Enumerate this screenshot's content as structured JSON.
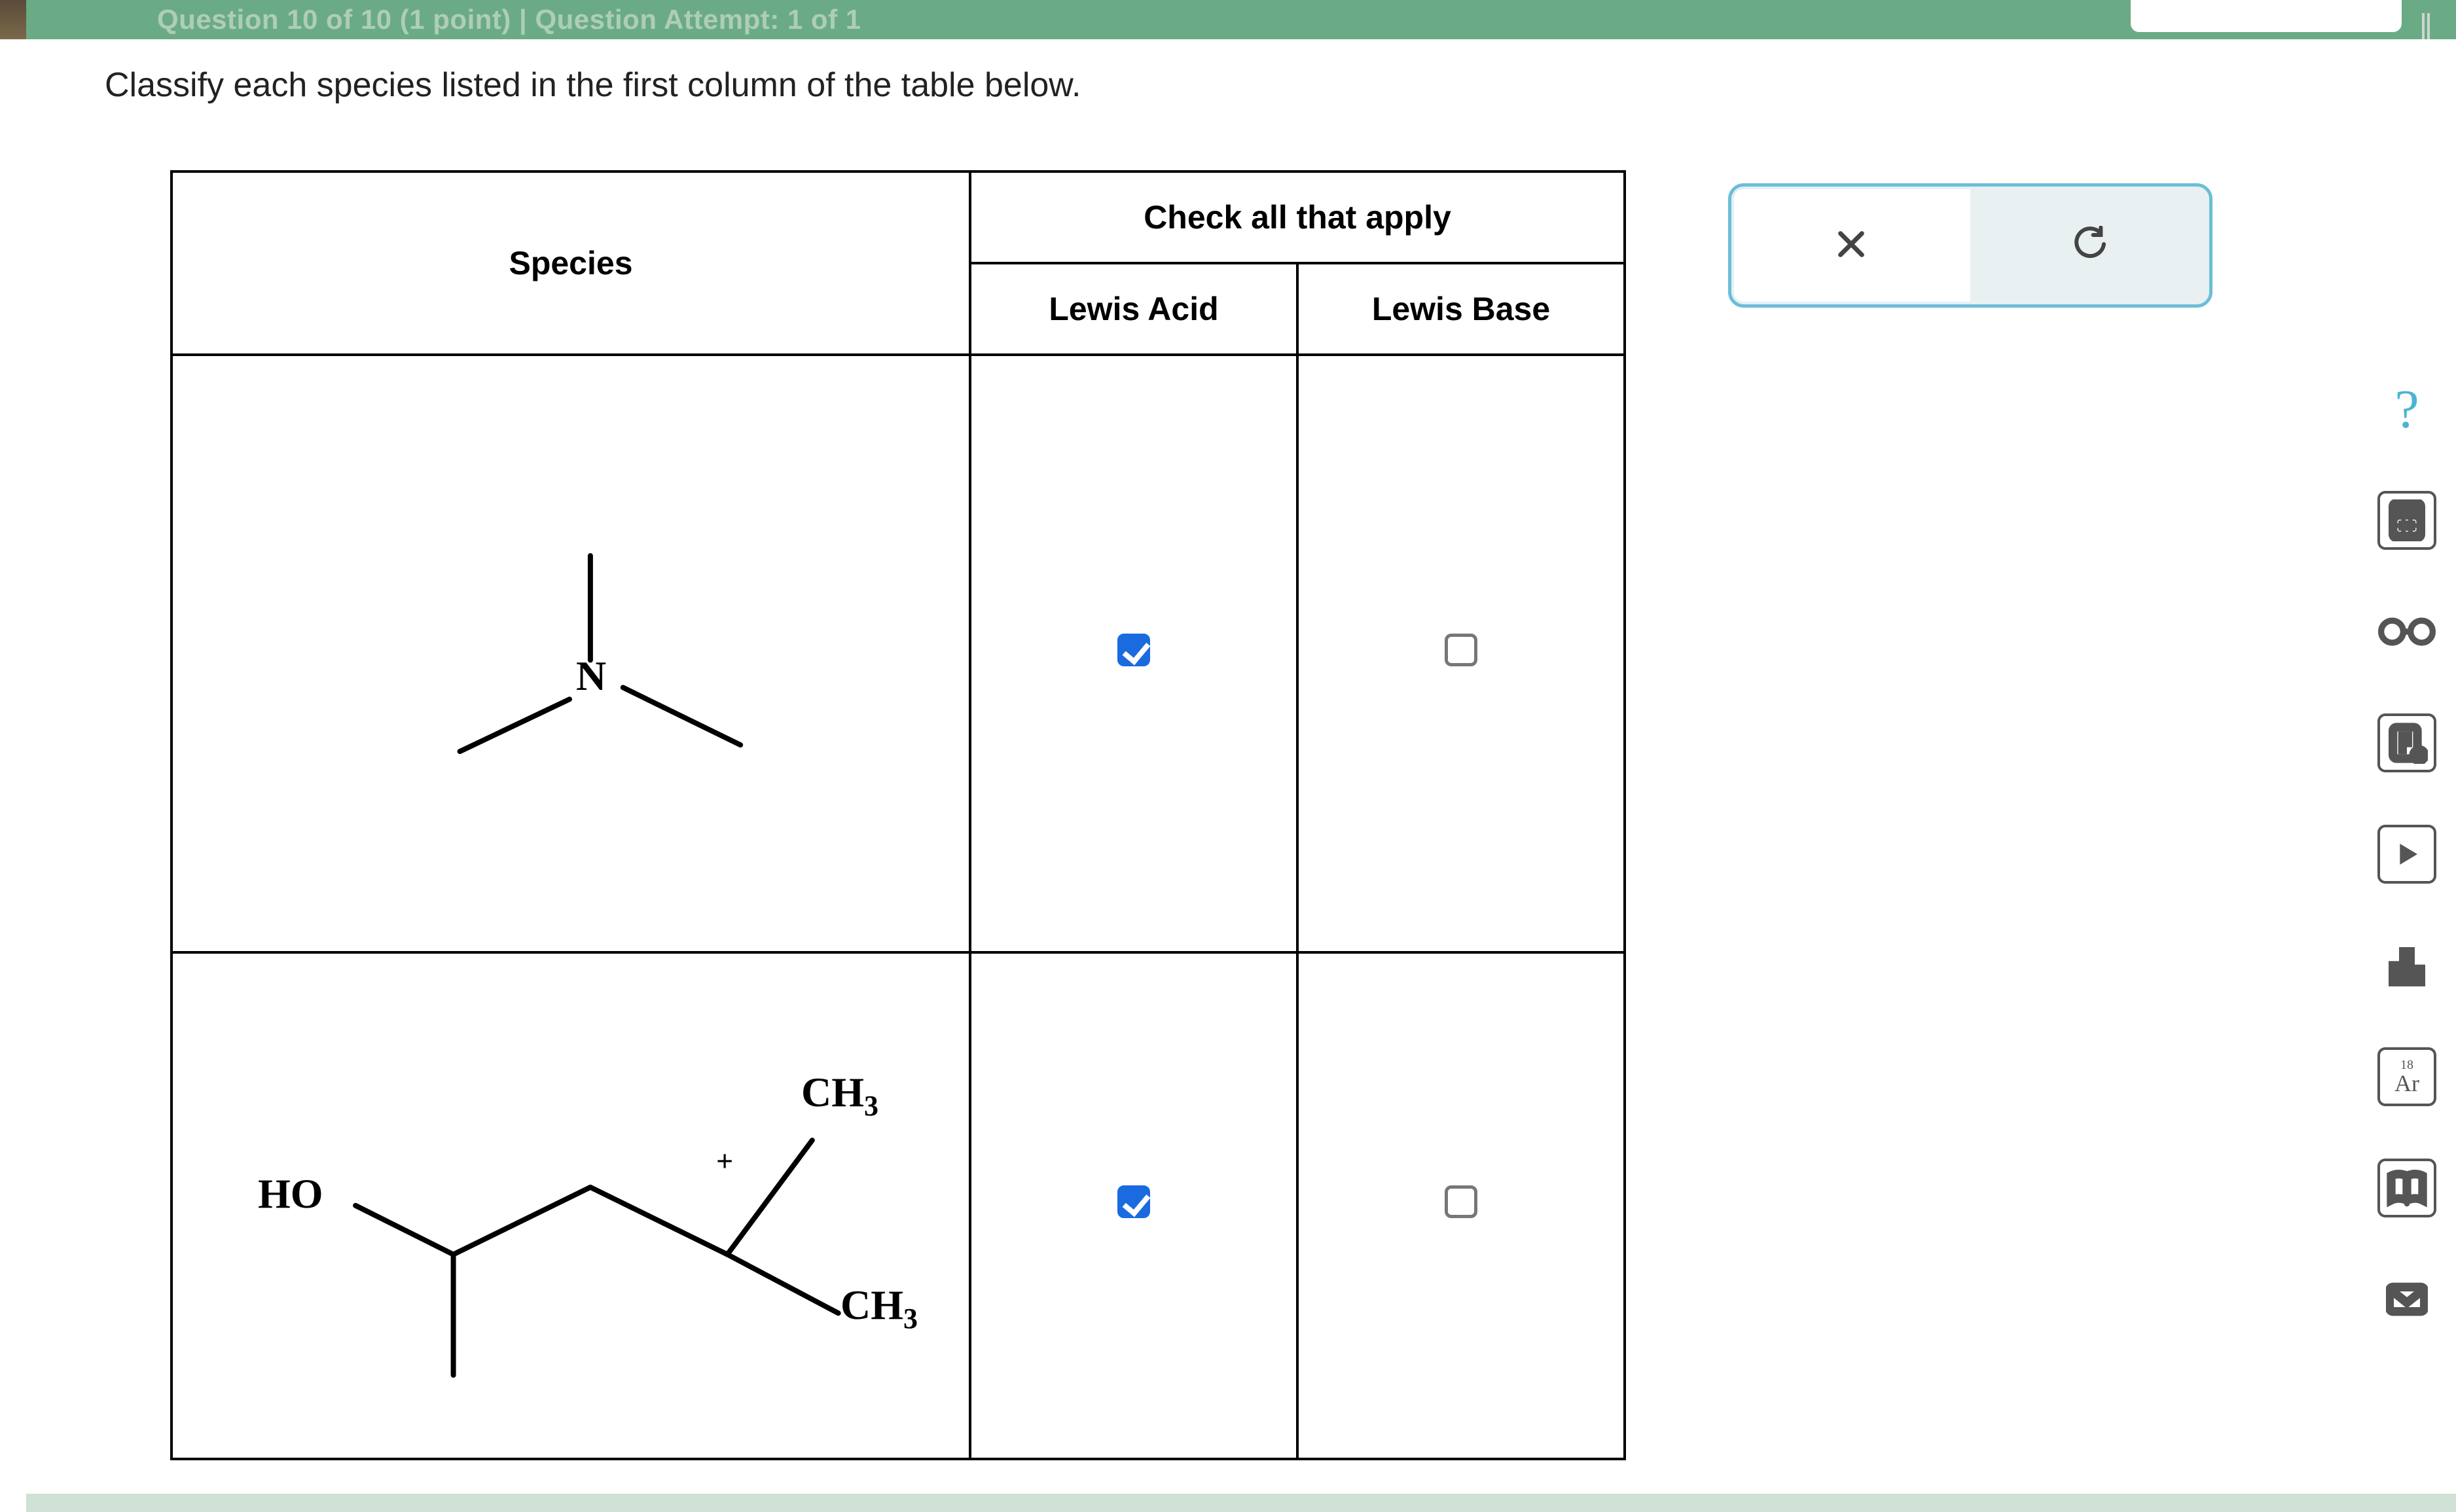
{
  "header": {
    "breadcrumb": "Question 10 of 10 (1 point)  |  Question Attempt: 1 of 1"
  },
  "prompt": "Classify each species listed in the first column of the table below.",
  "table": {
    "headers": {
      "species": "Species",
      "check_all": "Check all that apply",
      "acid": "Lewis Acid",
      "base": "Lewis Base"
    },
    "rows": [
      {
        "species_name": "trimethylamine",
        "labels": {
          "n": "N"
        },
        "acid_checked": true,
        "base_checked": false
      },
      {
        "species_name": "carbocation-hydroxy",
        "labels": {
          "ho": "HO",
          "ch3a": "CH",
          "sub3a": "3",
          "ch3b": "CH",
          "sub3b": "3",
          "plus": "+"
        },
        "acid_checked": true,
        "base_checked": false
      }
    ]
  },
  "feedback": {
    "wrong_icon": "close-x",
    "reset_icon": "reset-arrow"
  },
  "sidebar": {
    "items": [
      {
        "name": "help",
        "glyph": "?"
      },
      {
        "name": "calculator"
      },
      {
        "name": "glasses"
      },
      {
        "name": "notes"
      },
      {
        "name": "video"
      },
      {
        "name": "stats"
      },
      {
        "name": "periodic-table",
        "sup": "18",
        "text": "Ar"
      },
      {
        "name": "reference"
      },
      {
        "name": "mail"
      }
    ]
  }
}
